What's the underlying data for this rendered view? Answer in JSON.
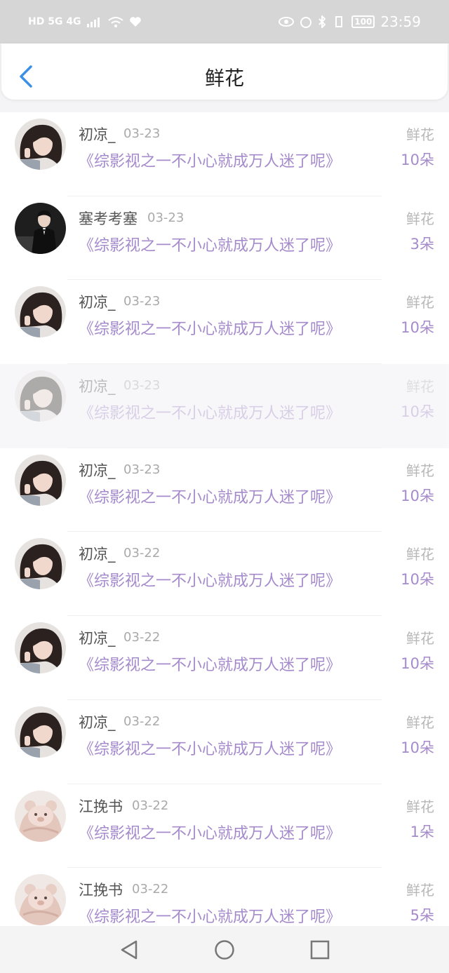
{
  "status_bar": {
    "left_text": "HD 5G 4G",
    "time": "23:59",
    "battery": "100"
  },
  "header": {
    "title": "鲜花"
  },
  "rows": [
    {
      "name": "初凉_",
      "date": "03-23",
      "book": "《综影视之一不小心就成万人迷了呢》",
      "type": "鲜花",
      "count": "10朵",
      "avatar": "girl"
    },
    {
      "name": "塞考考塞",
      "date": "03-23",
      "book": "《综影视之一不小心就成万人迷了呢》",
      "type": "鲜花",
      "count": "3朵",
      "avatar": "suit"
    },
    {
      "name": "初凉_",
      "date": "03-23",
      "book": "《综影视之一不小心就成万人迷了呢》",
      "type": "鲜花",
      "count": "10朵",
      "avatar": "girl"
    },
    {
      "name": "初凉_",
      "date": "03-23",
      "book": "《综影视之一不小心就成万人迷了呢》",
      "type": "鲜花",
      "count": "10朵",
      "avatar": "girl"
    },
    {
      "name": "初凉_",
      "date": "03-23",
      "book": "《综影视之一不小心就成万人迷了呢》",
      "type": "鲜花",
      "count": "10朵",
      "avatar": "girl"
    },
    {
      "name": "初凉_",
      "date": "03-22",
      "book": "《综影视之一不小心就成万人迷了呢》",
      "type": "鲜花",
      "count": "10朵",
      "avatar": "girl"
    },
    {
      "name": "初凉_",
      "date": "03-22",
      "book": "《综影视之一不小心就成万人迷了呢》",
      "type": "鲜花",
      "count": "10朵",
      "avatar": "girl"
    },
    {
      "name": "初凉_",
      "date": "03-22",
      "book": "《综影视之一不小心就成万人迷了呢》",
      "type": "鲜花",
      "count": "10朵",
      "avatar": "girl"
    },
    {
      "name": "江挽书",
      "date": "03-22",
      "book": "《综影视之一不小心就成万人迷了呢》",
      "type": "鲜花",
      "count": "1朵",
      "avatar": "bear"
    },
    {
      "name": "江挽书",
      "date": "03-22",
      "book": "《综影视之一不小心就成万人迷了呢》",
      "type": "鲜花",
      "count": "5朵",
      "avatar": "bear"
    }
  ],
  "colors": {
    "accent": "#a58bcc",
    "back": "#3b8fe6"
  }
}
